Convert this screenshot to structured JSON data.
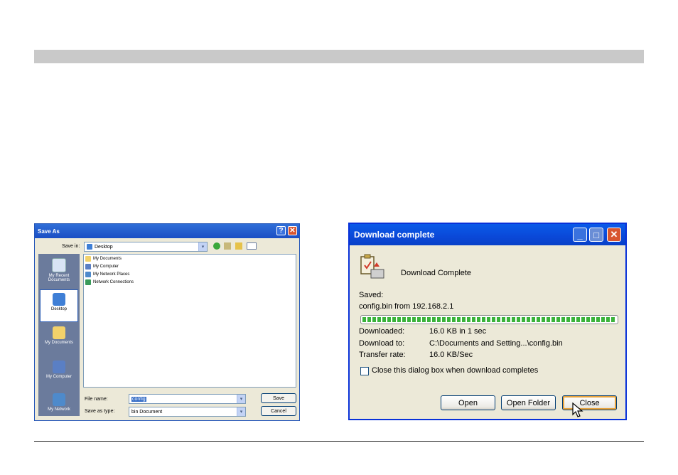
{
  "save_as": {
    "title": "Save As",
    "help_glyph": "?",
    "close_glyph": "✕",
    "save_in_label": "Save in:",
    "save_in_value": "Desktop",
    "places": [
      {
        "label": "My Recent Documents",
        "icon": "recent-documents-icon"
      },
      {
        "label": "Desktop",
        "icon": "desktop-icon",
        "selected": true
      },
      {
        "label": "My Documents",
        "icon": "my-documents-icon"
      },
      {
        "label": "My Computer",
        "icon": "my-computer-icon"
      },
      {
        "label": "My Network",
        "icon": "my-network-icon"
      }
    ],
    "files": [
      {
        "label": "My Documents",
        "icon": "folder-icon"
      },
      {
        "label": "My Computer",
        "icon": "computer-icon"
      },
      {
        "label": "My Network Places",
        "icon": "network-icon"
      },
      {
        "label": "Network Connections",
        "icon": "network-connections-icon"
      }
    ],
    "file_name_label": "File name:",
    "file_name_value": "config",
    "save_as_type_label": "Save as type:",
    "save_as_type_value": "bin Document",
    "save_button": "Save",
    "cancel_button": "Cancel"
  },
  "download": {
    "title": "Download complete",
    "min_glyph": "_",
    "max_glyph": "□",
    "close_glyph": "✕",
    "heading": "Download Complete",
    "saved_label": "Saved:",
    "saved_value": "config.bin from 192.168.2.1",
    "progress": 1.0,
    "downloaded_label": "Downloaded:",
    "downloaded_value": "16.0 KB in 1 sec",
    "download_to_label": "Download to:",
    "download_to_value": "C:\\Documents and Setting...\\config.bin",
    "transfer_rate_label": "Transfer rate:",
    "transfer_rate_value": "16.0 KB/Sec",
    "checkbox_label": "Close this dialog box when download completes",
    "checkbox_checked": false,
    "open_button": "Open",
    "open_folder_button": "Open Folder",
    "close_button": "Close"
  },
  "colors": {
    "xp_title_blue": "#0a48d8",
    "xp_close_red": "#d8552f",
    "dialog_bg": "#ece9d8",
    "progress_green": "#3bb33b",
    "page_bar_gray": "#c9c9c9"
  }
}
